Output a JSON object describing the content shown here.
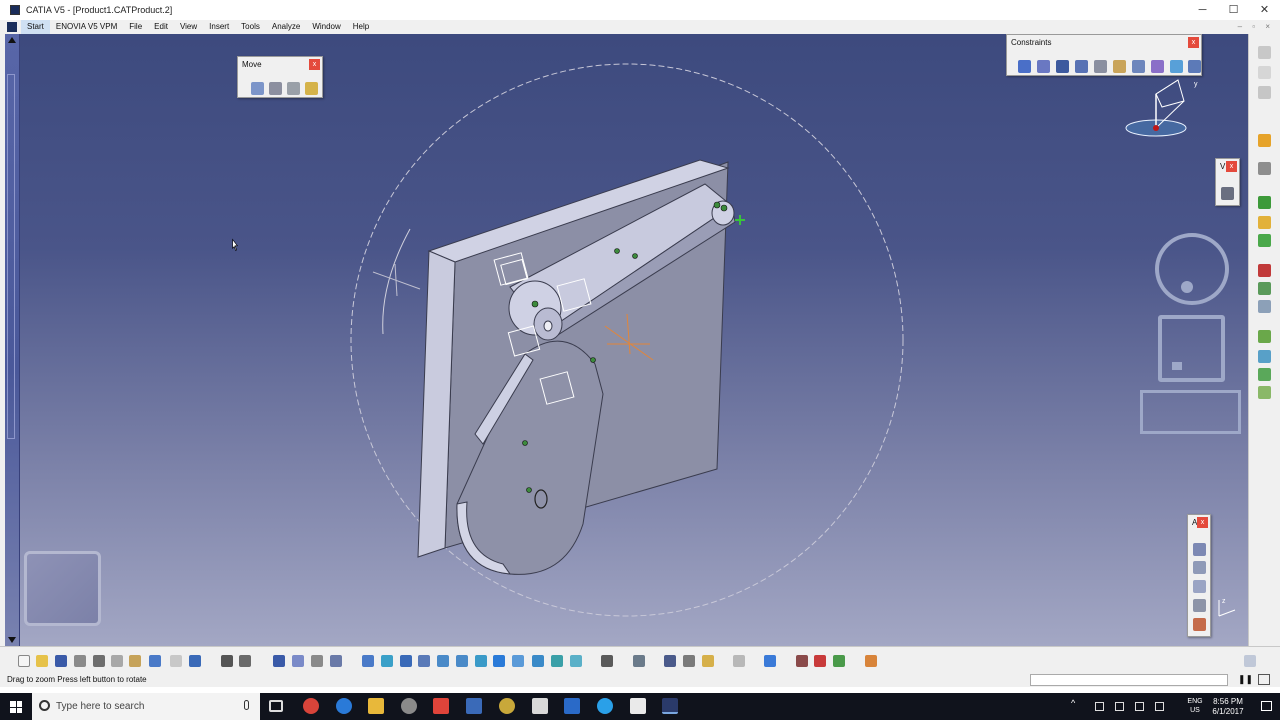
{
  "window": {
    "title": "CATIA V5 - [Product1.CATProduct.2]",
    "minimize": "─",
    "maximize": "☐",
    "close": "✕"
  },
  "menubar": {
    "items": [
      {
        "label": "Start"
      },
      {
        "label": "ENOVIA V5 VPM"
      },
      {
        "label": "File"
      },
      {
        "label": "Edit"
      },
      {
        "label": "View"
      },
      {
        "label": "Insert"
      },
      {
        "label": "Tools"
      },
      {
        "label": "Analyze"
      },
      {
        "label": "Window"
      },
      {
        "label": "Help"
      }
    ],
    "mdi_controls": "– ▫ ×"
  },
  "panels": {
    "move": {
      "title": "Move",
      "close": "x"
    },
    "constraints": {
      "title": "Constraints",
      "close": "x"
    },
    "small_v": {
      "title": "V",
      "close": "x"
    },
    "annotations": {
      "title": "A",
      "close": "x"
    }
  },
  "compass": {
    "x_label": "x",
    "y_label": "y",
    "z_label": "z"
  },
  "statusbar": {
    "text": "Drag to zoom  Press left button to rotate"
  },
  "taskbar": {
    "search_placeholder": "Type here to search",
    "lang_top": "ENG",
    "lang_bottom": "US",
    "time": "8:56 PM",
    "date": "6/1/2017"
  },
  "colors": {
    "background_top": "#3d4a7e",
    "background_bottom": "#a3a7c4",
    "part_face": "#8e91a8",
    "panel_close": "#e44a3c"
  }
}
